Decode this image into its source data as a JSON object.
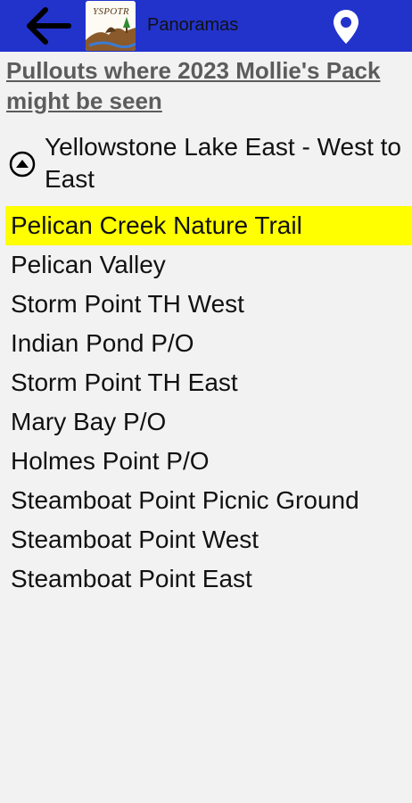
{
  "header": {
    "back_icon": "arrow-left-icon",
    "logo_text": "YSPOTR",
    "panoramas_label": "Panoramas",
    "map_icon": "map-pin-icon",
    "bar_color": "#2233cc"
  },
  "page_title": "Pullouts where 2023 Mollie's Pack might be seen",
  "section": {
    "title": "Yellowstone Lake East - West to East",
    "toggle_icon": "collapse-up-icon"
  },
  "highlight_color": "#ffff00",
  "items": [
    {
      "label": "Pelican Creek Nature Trail",
      "highlighted": true
    },
    {
      "label": "Pelican Valley",
      "highlighted": false
    },
    {
      "label": "Storm Point TH West",
      "highlighted": false
    },
    {
      "label": "Indian Pond P/O",
      "highlighted": false
    },
    {
      "label": "Storm Point TH East",
      "highlighted": false
    },
    {
      "label": "Mary Bay P/O",
      "highlighted": false
    },
    {
      "label": "Holmes Point P/O",
      "highlighted": false
    },
    {
      "label": "Steamboat Point Picnic Ground",
      "highlighted": false
    },
    {
      "label": "Steamboat Point West",
      "highlighted": false
    },
    {
      "label": "Steamboat Point East",
      "highlighted": false
    }
  ]
}
